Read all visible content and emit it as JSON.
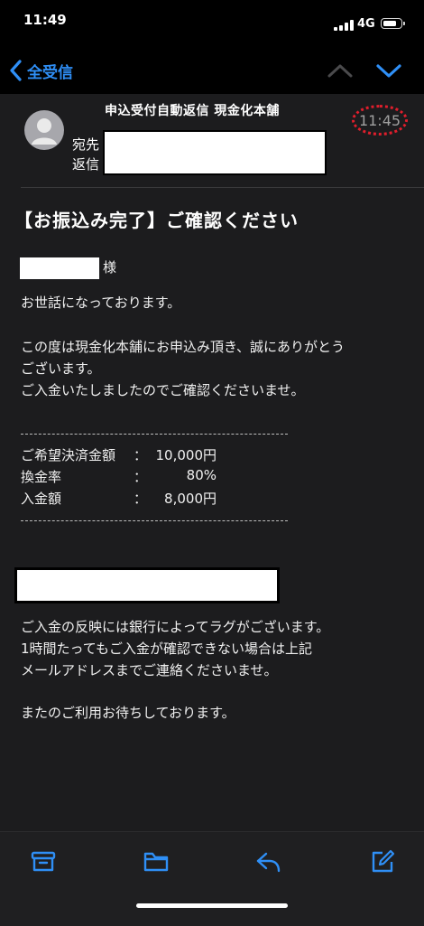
{
  "status_bar": {
    "time": "11:49",
    "network": "4G"
  },
  "nav": {
    "back_label": "全受信"
  },
  "header": {
    "sender": "申込受付自動返信 現金化本舗",
    "time": "11:45",
    "to_label": "宛先",
    "reply_label": "返信"
  },
  "body": {
    "subject": "【お振込み完了】ご確認ください",
    "honorific": "様",
    "greeting": "お世話になっております。",
    "thanks_line1": "この度は現金化本舗にお申込み頂き、誠にありがとう",
    "thanks_line2": "ございます。",
    "confirm": "ご入金いたしましたのでご確認くださいませ。",
    "rows": [
      {
        "label": "ご希望決済金額",
        "colon": "：",
        "value": "10,000円"
      },
      {
        "label": "換金率",
        "colon": "：",
        "value": "80%"
      },
      {
        "label": "入金額",
        "colon": "：",
        "value": "8,000円"
      }
    ],
    "lag_line1": "ご入金の反映には銀行によってラグがございます。",
    "lag_line2": "1時間たってもご入金が確認できない場合は上記",
    "lag_line3": "メールアドレスまでご連絡くださいませ。",
    "closing": "またのご利用お待ちしております。"
  },
  "toolbar": {
    "icons": [
      "archive-icon",
      "folder-icon",
      "reply-icon",
      "compose-icon"
    ]
  },
  "colors": {
    "accent": "#2f8ff6",
    "background": "#1c1c1e",
    "highlight_circle": "#e01e2c"
  }
}
